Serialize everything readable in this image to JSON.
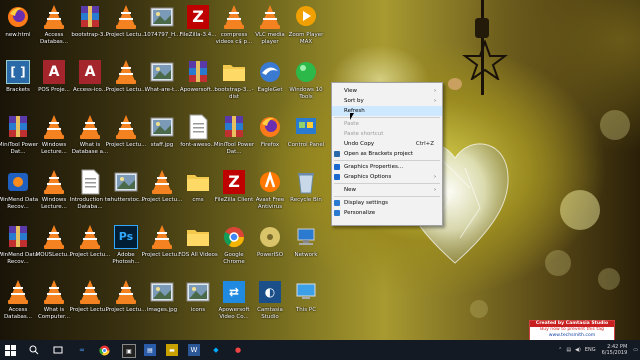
{
  "desktop": {
    "icons": [
      {
        "label": "new.html",
        "kind": "firefox"
      },
      {
        "label": "Access Databas...",
        "kind": "vlc"
      },
      {
        "label": "bootstrap-3...",
        "kind": "winrar"
      },
      {
        "label": "Project Lectu...",
        "kind": "vlc"
      },
      {
        "label": "1074797_H...",
        "kind": "photo"
      },
      {
        "label": "FileZilla-3.4...",
        "kind": "filezilla"
      },
      {
        "label": "compress videos c$ p...",
        "kind": "vlc"
      },
      {
        "label": "VLC media player",
        "kind": "vlc"
      },
      {
        "label": "Zoom Player MAX",
        "kind": "zoom"
      },
      {
        "label": "Brackets",
        "kind": "brackets"
      },
      {
        "label": "POS Proje...",
        "kind": "access"
      },
      {
        "label": "Access-ico...",
        "kind": "access"
      },
      {
        "label": "Project Lectu...",
        "kind": "vlc"
      },
      {
        "label": "What-are-t...",
        "kind": "photo"
      },
      {
        "label": "Apowersoft...",
        "kind": "winrar"
      },
      {
        "label": "bootstrap-3...-dist",
        "kind": "folder"
      },
      {
        "label": "EagleGet",
        "kind": "eagleget"
      },
      {
        "label": "Windows 10 Tools",
        "kind": "greenball"
      },
      {
        "label": "MiniTool Power Dat...",
        "kind": "winrar"
      },
      {
        "label": "Windows Lecture...",
        "kind": "vlc"
      },
      {
        "label": "What is Database a...",
        "kind": "vlc"
      },
      {
        "label": "Project Lectu...",
        "kind": "vlc"
      },
      {
        "label": "staff.jpg",
        "kind": "photo"
      },
      {
        "label": "font-aweso...",
        "kind": "doc"
      },
      {
        "label": "MiniTool Power Dat...",
        "kind": "winrar"
      },
      {
        "label": "Firefox",
        "kind": "firefox"
      },
      {
        "label": "Control Panel",
        "kind": "control"
      },
      {
        "label": "WinMend Data Recov...",
        "kind": "winmend"
      },
      {
        "label": "Windows Lecture...",
        "kind": "vlc"
      },
      {
        "label": "Introduction to Databa...",
        "kind": "doc"
      },
      {
        "label": "shutterstoc...",
        "kind": "photo"
      },
      {
        "label": "Project Lectu...",
        "kind": "vlc"
      },
      {
        "label": "cms",
        "kind": "folder"
      },
      {
        "label": "FileZilla Client",
        "kind": "filezilla"
      },
      {
        "label": "Avast Free Antivirus",
        "kind": "avast"
      },
      {
        "label": "Recycle Bin",
        "kind": "recycle"
      },
      {
        "label": "WinMend Data Recov...",
        "kind": "winrar"
      },
      {
        "label": "MOUSLectu...",
        "kind": "vlc"
      },
      {
        "label": "Project Lectu...",
        "kind": "vlc"
      },
      {
        "label": "Adobe Photosh...",
        "kind": "photoshop"
      },
      {
        "label": "Project Lectu...",
        "kind": "vlc"
      },
      {
        "label": "FOS All Videos",
        "kind": "folder"
      },
      {
        "label": "Google Chrome",
        "kind": "chrome"
      },
      {
        "label": "PowerISO",
        "kind": "poweriso"
      },
      {
        "label": "Network",
        "kind": "network"
      },
      {
        "label": "Access Databas...",
        "kind": "vlc"
      },
      {
        "label": "What is Computer...",
        "kind": "vlc"
      },
      {
        "label": "Project Lectu...",
        "kind": "vlc"
      },
      {
        "label": "Project Lectu...",
        "kind": "vlc"
      },
      {
        "label": "images.jpg",
        "kind": "photo"
      },
      {
        "label": "icons",
        "kind": "photo"
      },
      {
        "label": "Apowersoft Video Co...",
        "kind": "apowersoft"
      },
      {
        "label": "Camtasia Studio",
        "kind": "camtasia"
      },
      {
        "label": "This PC",
        "kind": "thispc"
      }
    ]
  },
  "context_menu": {
    "items": [
      {
        "label": "View",
        "submenu": true
      },
      {
        "label": "Sort by",
        "submenu": true
      },
      {
        "label": "Refresh",
        "hover": true
      },
      {
        "sep": true
      },
      {
        "label": "Paste",
        "disabled": true
      },
      {
        "label": "Paste shortcut",
        "disabled": true
      },
      {
        "label": "Undo Copy",
        "shortcut": "Ctrl+Z"
      },
      {
        "label": "Open as Brackets project",
        "icon": "brackets"
      },
      {
        "sep": true
      },
      {
        "label": "Graphics Properties...",
        "icon": "intel"
      },
      {
        "label": "Graphics Options",
        "submenu": true,
        "icon": "intel"
      },
      {
        "sep": true
      },
      {
        "label": "New",
        "submenu": true
      },
      {
        "sep": true
      },
      {
        "label": "Display settings",
        "icon": "display"
      },
      {
        "label": "Personalize",
        "icon": "personalize"
      }
    ]
  },
  "watermark": {
    "line1": "Created by Camtasia Studio",
    "line2": "Buy now to prevent this tag",
    "line3": "www.techsmith.com"
  },
  "taskbar": {
    "language": "ENG",
    "time": "2:42 PM",
    "date": "6/15/2019"
  },
  "colors": {
    "taskbar": "#141a24",
    "menu_bg": "#f2f2f2",
    "menu_hover": "#cde8ff",
    "watermark_red": "#c82020"
  }
}
